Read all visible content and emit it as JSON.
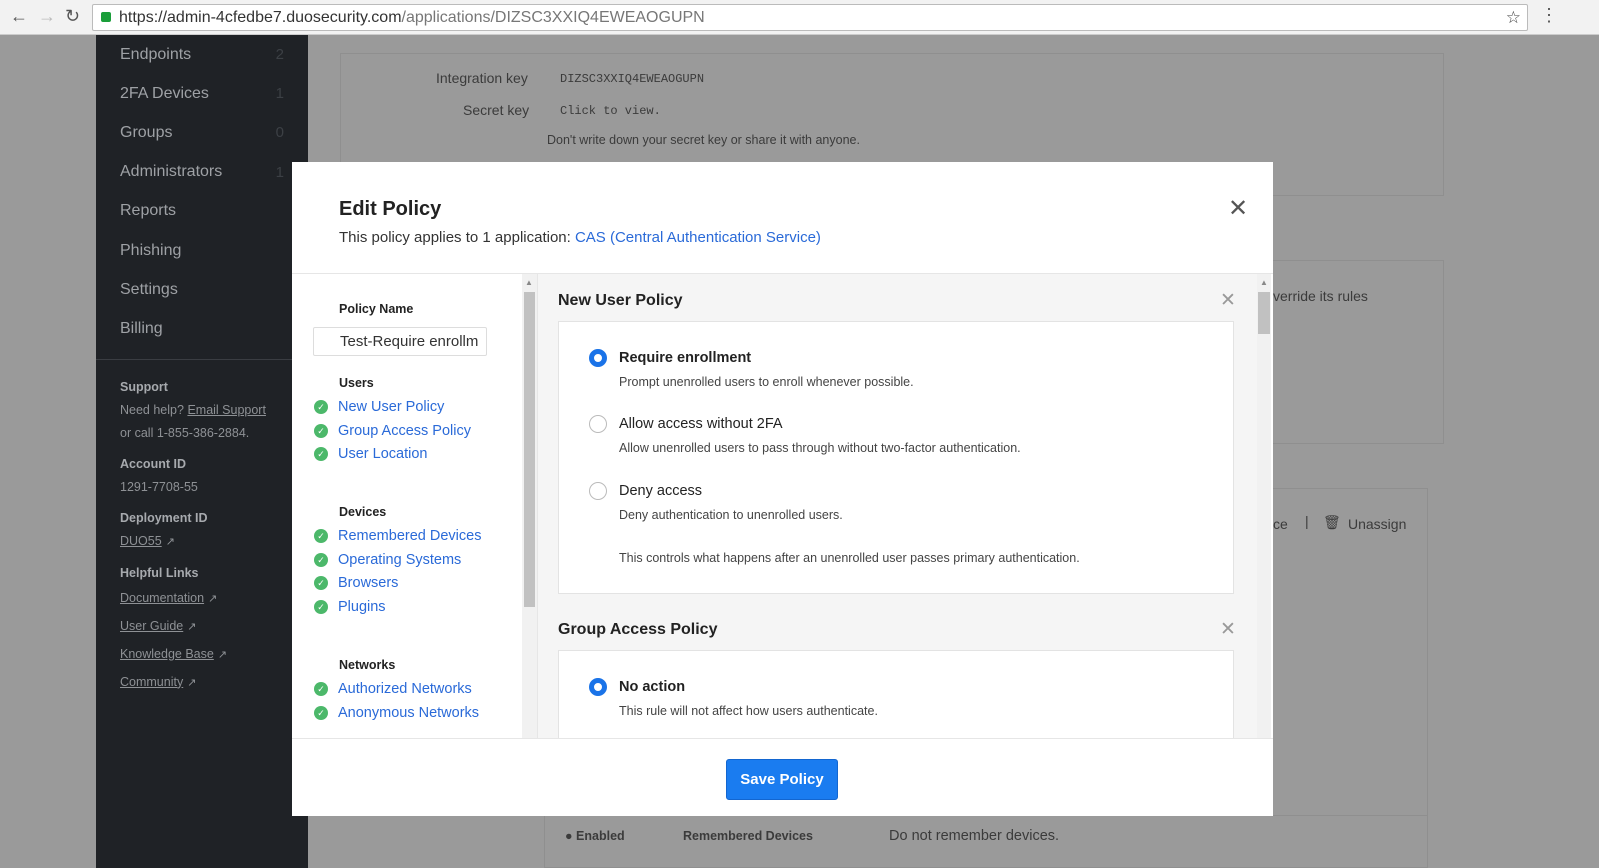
{
  "browser": {
    "url_host": "https://admin-4cfedbe7.duosecurity.com",
    "url_path": "/applications/DIZSC3XXIQ4EWEAOGUPN"
  },
  "sidebar": {
    "items": [
      {
        "label": "Endpoints",
        "count": "2"
      },
      {
        "label": "2FA Devices",
        "count": "1"
      },
      {
        "label": "Groups",
        "count": "0"
      },
      {
        "label": "Administrators",
        "count": "1"
      },
      {
        "label": "Reports",
        "count": ""
      },
      {
        "label": "Phishing",
        "count": ""
      },
      {
        "label": "Settings",
        "count": ""
      },
      {
        "label": "Billing",
        "count": ""
      }
    ],
    "support_title": "Support",
    "support_text": "Need help?",
    "email_support": "Email Support",
    "call_text": "or call 1-855-386-2884.",
    "account_id_title": "Account ID",
    "account_id": "1291-7708-55",
    "deployment_id_title": "Deployment ID",
    "deployment_id": "DUO55",
    "helpful_links_title": "Helpful Links",
    "links": [
      "Documentation",
      "User Guide",
      "Knowledge Base",
      "Community"
    ]
  },
  "background": {
    "integration_key_label": "Integration key",
    "integration_key": "DIZSC3XXIQ4EWEAOGUPN",
    "secret_key_label": "Secret key",
    "secret_key": "Click to view.",
    "secret_warning": "Don't write down your secret key or share it with anyone.",
    "override_text": "verride its rules",
    "device_text": "ce",
    "unassign": "Unassign",
    "enabled": "Enabled",
    "remembered_devices": "Remembered Devices",
    "remembered_value": "Do not remember devices."
  },
  "modal": {
    "title": "Edit Policy",
    "subtitle": "This policy applies to 1 application: ",
    "app_link": "CAS (Central Authentication Service)",
    "policy_name_label": "Policy Name",
    "policy_name_value": "Test-Require enrollm",
    "groups": [
      {
        "title": "Users",
        "items": [
          "New User Policy",
          "Group Access Policy",
          "User Location"
        ]
      },
      {
        "title": "Devices",
        "items": [
          "Remembered Devices",
          "Operating Systems",
          "Browsers",
          "Plugins"
        ]
      },
      {
        "title": "Networks",
        "items": [
          "Authorized Networks",
          "Anonymous Networks"
        ]
      }
    ],
    "new_user_policy": {
      "title": "New User Policy",
      "options": [
        {
          "label": "Require enrollment",
          "desc": "Prompt unenrolled users to enroll whenever possible.",
          "selected": true
        },
        {
          "label": "Allow access without 2FA",
          "desc": "Allow unenrolled users to pass through without two-factor authentication.",
          "selected": false
        },
        {
          "label": "Deny access",
          "desc": "Deny authentication to unenrolled users.",
          "selected": false
        }
      ],
      "note": "This controls what happens after an unenrolled user passes primary authentication."
    },
    "group_access_policy": {
      "title": "Group Access Policy",
      "options": [
        {
          "label": "No action",
          "desc": "This rule will not affect how users authenticate.",
          "selected": true
        }
      ]
    },
    "save_label": "Save Policy"
  },
  "colors": {
    "accent": "#1a7cf0",
    "link": "#2a6ad8",
    "check": "#4cb86a",
    "sidebar": "#1f2226"
  }
}
